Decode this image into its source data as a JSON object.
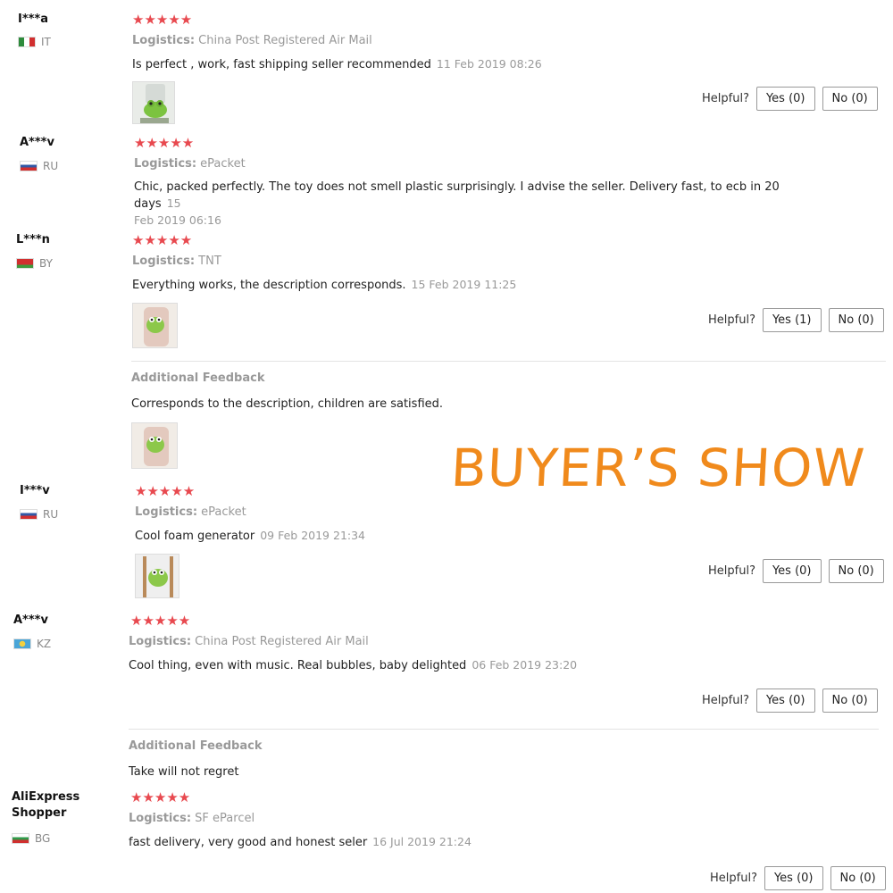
{
  "helpful_label": "Helpful?",
  "additional_feedback_label": "Additional Feedback",
  "logistics_label": "Logistics:",
  "stars_text": "★★★★★",
  "watermark": "BUYER’S SHOW",
  "colors": {
    "star": "#e8494f",
    "watermark": "#f08a1c",
    "muted": "#999999"
  },
  "reviews": [
    {
      "user": "I***a",
      "country": "IT",
      "flag": "it-flag",
      "logistics": "China Post Registered Air Mail",
      "text": "Is perfect , work, fast shipping seller recommended",
      "date": "11 Feb 2019 08:26",
      "yes": "Yes (0)",
      "no": "No (0)"
    },
    {
      "user": "A***v",
      "country": "RU",
      "flag": "ru-flag",
      "logistics": "ePacket",
      "text": "Chic, packed perfectly. The toy does not smell plastic surprisingly. I advise the seller. Delivery fast, to ecb in 20 days",
      "date_part1": "15",
      "date_part2": "Feb 2019 06:16"
    },
    {
      "user": "L***n",
      "country": "BY",
      "flag": "by-flag",
      "logistics": "TNT",
      "text": "Everything works, the description corresponds.",
      "date": "15 Feb 2019 11:25",
      "yes": "Yes (1)",
      "no": "No (0)",
      "additional": "Corresponds to the description, children are satisfied."
    },
    {
      "user": "I***v",
      "country": "RU",
      "flag": "ru-flag",
      "logistics": "ePacket",
      "text": "Cool foam generator",
      "date": "09 Feb 2019 21:34",
      "yes": "Yes (0)",
      "no": "No (0)"
    },
    {
      "user": "A***v",
      "country": "KZ",
      "flag": "kz-flag",
      "logistics": "China Post Registered Air Mail",
      "text": "Cool thing, even with music. Real bubbles, baby delighted",
      "date": "06 Feb 2019 23:20",
      "yes": "Yes (0)",
      "no": "No (0)",
      "additional": "Take will not regret"
    },
    {
      "user": "AliExpress Shopper",
      "user_line1": "AliExpress",
      "user_line2": "Shopper",
      "country": "BG",
      "flag": "bg-flag",
      "logistics": "SF eParcel",
      "text": "fast delivery, very good and honest seler",
      "date": "16 Jul 2019 21:24",
      "yes": "Yes (0)",
      "no": "No (0)"
    }
  ]
}
